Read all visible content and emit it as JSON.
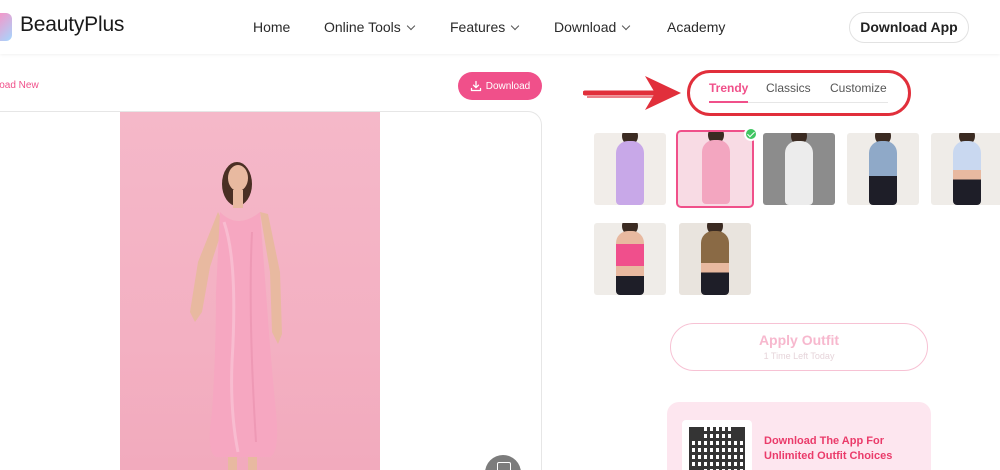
{
  "header": {
    "brand": "BeautyPlus",
    "nav": [
      {
        "label": "Home",
        "has_dropdown": false
      },
      {
        "label": "Online Tools",
        "has_dropdown": true
      },
      {
        "label": "Features",
        "has_dropdown": true
      },
      {
        "label": "Download",
        "has_dropdown": true
      },
      {
        "label": "Academy",
        "has_dropdown": false
      }
    ],
    "download_app_label": "Download App"
  },
  "toolbar": {
    "upload_new_label": "load New",
    "download_label": "Download",
    "download_icon": "download-icon"
  },
  "tabs": {
    "items": [
      "Trendy",
      "Classics",
      "Customize"
    ],
    "active": "Trendy"
  },
  "outfits": [
    {
      "name": "lavender-slip-dress",
      "color": "#c8a8e8",
      "selected": false
    },
    {
      "name": "pink-satin-dress",
      "color": "#f3a6c0",
      "selected": true
    },
    {
      "name": "white-lace-top",
      "color": "#e6e6e6",
      "selected": false
    },
    {
      "name": "denim-corset-top",
      "color": "#8fa9c8",
      "selected": false
    },
    {
      "name": "tie-dye-halter-top",
      "color": "#c9d8f0",
      "selected": false
    },
    {
      "name": "pink-heart-top",
      "color": "#f04f8c",
      "selected": false
    },
    {
      "name": "leopard-halter-top",
      "color": "#8a6a45",
      "selected": false
    }
  ],
  "apply": {
    "label": "Apply Outfit",
    "sublabel": "1 Time Left Today"
  },
  "promo": {
    "text": "Download The App For Unlimited Outfit Choices"
  },
  "colors": {
    "accent": "#f0508a",
    "annotation_red": "#e12f3b",
    "success": "#3fc561"
  }
}
